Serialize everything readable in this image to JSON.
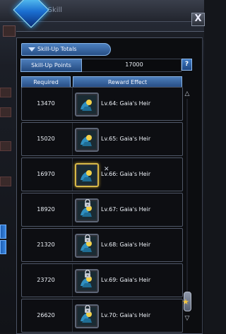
{
  "background_window": {
    "title_partial": "Team Skill"
  },
  "panel": {
    "title": "Skill-Up Totals",
    "points_label": "Skill-Up Points",
    "points_value": "17000",
    "help_label": "?",
    "columns": {
      "required": "Required",
      "reward": "Reward Effect"
    },
    "rows": [
      {
        "required": "13470",
        "reward": "Lv.64: Gaia's Heir",
        "locked": false,
        "selected": false
      },
      {
        "required": "15020",
        "reward": "Lv.65: Gaia's Heir",
        "locked": false,
        "selected": false
      },
      {
        "required": "16970",
        "reward": "Lv.66: Gaia's Heir",
        "locked": false,
        "selected": true
      },
      {
        "required": "18920",
        "reward": "Lv.67: Gaia's Heir",
        "locked": true,
        "selected": false
      },
      {
        "required": "21320",
        "reward": "Lv.68: Gaia's Heir",
        "locked": true,
        "selected": false
      },
      {
        "required": "23720",
        "reward": "Lv.69: Gaia's Heir",
        "locked": true,
        "selected": false
      },
      {
        "required": "26620",
        "reward": "Lv.70: Gaia's Heir",
        "locked": true,
        "selected": false
      }
    ]
  },
  "close_label": "X",
  "icons": {
    "skill": "gaia-heir-skill-icon",
    "lock": "lock-icon",
    "favorite": "star-icon"
  },
  "colors": {
    "accent_blue": "#4d7ebb",
    "selected_gold": "#d7b949",
    "panel_bg": "#0c0d10"
  }
}
